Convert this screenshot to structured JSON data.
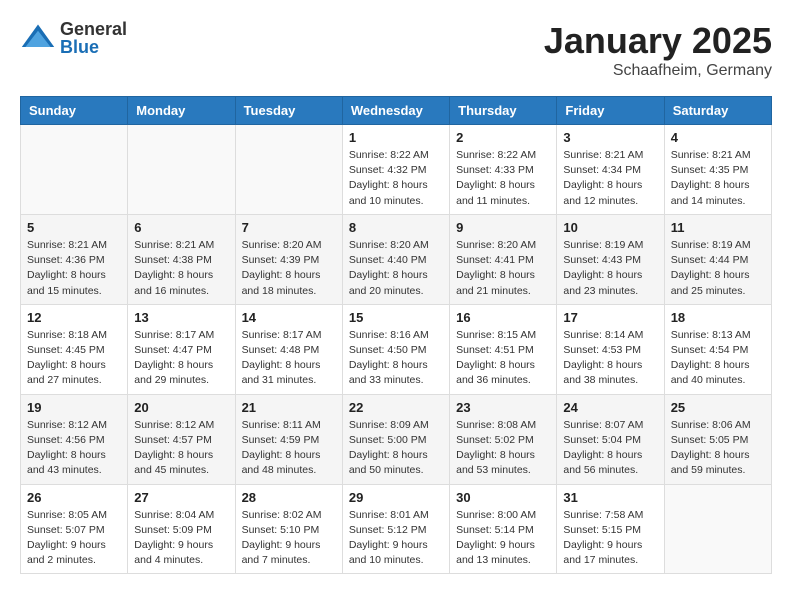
{
  "header": {
    "logo_general": "General",
    "logo_blue": "Blue",
    "month_title": "January 2025",
    "location": "Schaafheim, Germany"
  },
  "weekdays": [
    "Sunday",
    "Monday",
    "Tuesday",
    "Wednesday",
    "Thursday",
    "Friday",
    "Saturday"
  ],
  "weeks": [
    [
      {
        "day": "",
        "sunrise": "",
        "sunset": "",
        "daylight": ""
      },
      {
        "day": "",
        "sunrise": "",
        "sunset": "",
        "daylight": ""
      },
      {
        "day": "",
        "sunrise": "",
        "sunset": "",
        "daylight": ""
      },
      {
        "day": "1",
        "sunrise": "Sunrise: 8:22 AM",
        "sunset": "Sunset: 4:32 PM",
        "daylight": "Daylight: 8 hours and 10 minutes."
      },
      {
        "day": "2",
        "sunrise": "Sunrise: 8:22 AM",
        "sunset": "Sunset: 4:33 PM",
        "daylight": "Daylight: 8 hours and 11 minutes."
      },
      {
        "day": "3",
        "sunrise": "Sunrise: 8:21 AM",
        "sunset": "Sunset: 4:34 PM",
        "daylight": "Daylight: 8 hours and 12 minutes."
      },
      {
        "day": "4",
        "sunrise": "Sunrise: 8:21 AM",
        "sunset": "Sunset: 4:35 PM",
        "daylight": "Daylight: 8 hours and 14 minutes."
      }
    ],
    [
      {
        "day": "5",
        "sunrise": "Sunrise: 8:21 AM",
        "sunset": "Sunset: 4:36 PM",
        "daylight": "Daylight: 8 hours and 15 minutes."
      },
      {
        "day": "6",
        "sunrise": "Sunrise: 8:21 AM",
        "sunset": "Sunset: 4:38 PM",
        "daylight": "Daylight: 8 hours and 16 minutes."
      },
      {
        "day": "7",
        "sunrise": "Sunrise: 8:20 AM",
        "sunset": "Sunset: 4:39 PM",
        "daylight": "Daylight: 8 hours and 18 minutes."
      },
      {
        "day": "8",
        "sunrise": "Sunrise: 8:20 AM",
        "sunset": "Sunset: 4:40 PM",
        "daylight": "Daylight: 8 hours and 20 minutes."
      },
      {
        "day": "9",
        "sunrise": "Sunrise: 8:20 AM",
        "sunset": "Sunset: 4:41 PM",
        "daylight": "Daylight: 8 hours and 21 minutes."
      },
      {
        "day": "10",
        "sunrise": "Sunrise: 8:19 AM",
        "sunset": "Sunset: 4:43 PM",
        "daylight": "Daylight: 8 hours and 23 minutes."
      },
      {
        "day": "11",
        "sunrise": "Sunrise: 8:19 AM",
        "sunset": "Sunset: 4:44 PM",
        "daylight": "Daylight: 8 hours and 25 minutes."
      }
    ],
    [
      {
        "day": "12",
        "sunrise": "Sunrise: 8:18 AM",
        "sunset": "Sunset: 4:45 PM",
        "daylight": "Daylight: 8 hours and 27 minutes."
      },
      {
        "day": "13",
        "sunrise": "Sunrise: 8:17 AM",
        "sunset": "Sunset: 4:47 PM",
        "daylight": "Daylight: 8 hours and 29 minutes."
      },
      {
        "day": "14",
        "sunrise": "Sunrise: 8:17 AM",
        "sunset": "Sunset: 4:48 PM",
        "daylight": "Daylight: 8 hours and 31 minutes."
      },
      {
        "day": "15",
        "sunrise": "Sunrise: 8:16 AM",
        "sunset": "Sunset: 4:50 PM",
        "daylight": "Daylight: 8 hours and 33 minutes."
      },
      {
        "day": "16",
        "sunrise": "Sunrise: 8:15 AM",
        "sunset": "Sunset: 4:51 PM",
        "daylight": "Daylight: 8 hours and 36 minutes."
      },
      {
        "day": "17",
        "sunrise": "Sunrise: 8:14 AM",
        "sunset": "Sunset: 4:53 PM",
        "daylight": "Daylight: 8 hours and 38 minutes."
      },
      {
        "day": "18",
        "sunrise": "Sunrise: 8:13 AM",
        "sunset": "Sunset: 4:54 PM",
        "daylight": "Daylight: 8 hours and 40 minutes."
      }
    ],
    [
      {
        "day": "19",
        "sunrise": "Sunrise: 8:12 AM",
        "sunset": "Sunset: 4:56 PM",
        "daylight": "Daylight: 8 hours and 43 minutes."
      },
      {
        "day": "20",
        "sunrise": "Sunrise: 8:12 AM",
        "sunset": "Sunset: 4:57 PM",
        "daylight": "Daylight: 8 hours and 45 minutes."
      },
      {
        "day": "21",
        "sunrise": "Sunrise: 8:11 AM",
        "sunset": "Sunset: 4:59 PM",
        "daylight": "Daylight: 8 hours and 48 minutes."
      },
      {
        "day": "22",
        "sunrise": "Sunrise: 8:09 AM",
        "sunset": "Sunset: 5:00 PM",
        "daylight": "Daylight: 8 hours and 50 minutes."
      },
      {
        "day": "23",
        "sunrise": "Sunrise: 8:08 AM",
        "sunset": "Sunset: 5:02 PM",
        "daylight": "Daylight: 8 hours and 53 minutes."
      },
      {
        "day": "24",
        "sunrise": "Sunrise: 8:07 AM",
        "sunset": "Sunset: 5:04 PM",
        "daylight": "Daylight: 8 hours and 56 minutes."
      },
      {
        "day": "25",
        "sunrise": "Sunrise: 8:06 AM",
        "sunset": "Sunset: 5:05 PM",
        "daylight": "Daylight: 8 hours and 59 minutes."
      }
    ],
    [
      {
        "day": "26",
        "sunrise": "Sunrise: 8:05 AM",
        "sunset": "Sunset: 5:07 PM",
        "daylight": "Daylight: 9 hours and 2 minutes."
      },
      {
        "day": "27",
        "sunrise": "Sunrise: 8:04 AM",
        "sunset": "Sunset: 5:09 PM",
        "daylight": "Daylight: 9 hours and 4 minutes."
      },
      {
        "day": "28",
        "sunrise": "Sunrise: 8:02 AM",
        "sunset": "Sunset: 5:10 PM",
        "daylight": "Daylight: 9 hours and 7 minutes."
      },
      {
        "day": "29",
        "sunrise": "Sunrise: 8:01 AM",
        "sunset": "Sunset: 5:12 PM",
        "daylight": "Daylight: 9 hours and 10 minutes."
      },
      {
        "day": "30",
        "sunrise": "Sunrise: 8:00 AM",
        "sunset": "Sunset: 5:14 PM",
        "daylight": "Daylight: 9 hours and 13 minutes."
      },
      {
        "day": "31",
        "sunrise": "Sunrise: 7:58 AM",
        "sunset": "Sunset: 5:15 PM",
        "daylight": "Daylight: 9 hours and 17 minutes."
      },
      {
        "day": "",
        "sunrise": "",
        "sunset": "",
        "daylight": ""
      }
    ]
  ]
}
